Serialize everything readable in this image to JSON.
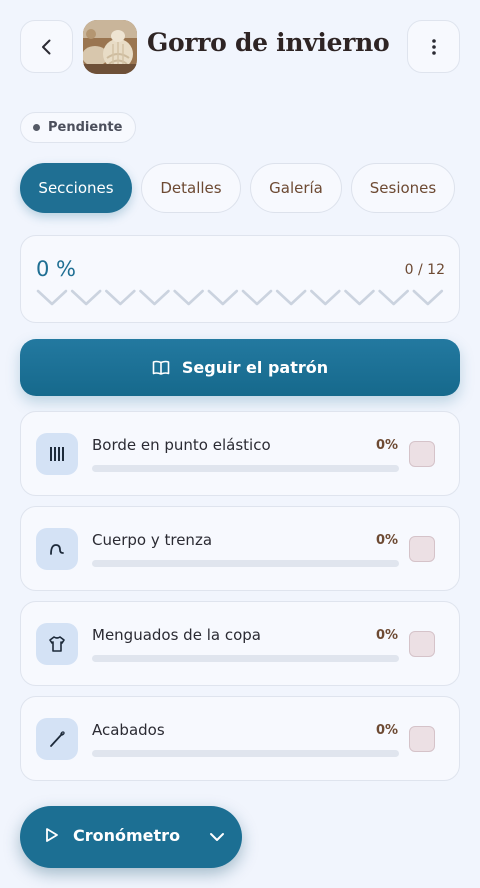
{
  "header": {
    "title": "Gorro de invierno",
    "thumbnail_icon": "knitted-hat-photo",
    "back_icon": "chevron-left-icon",
    "more_icon": "more-vertical-icon"
  },
  "status": {
    "label": "Pendiente"
  },
  "tabs": [
    {
      "label": "Secciones",
      "active": true
    },
    {
      "label": "Detalles",
      "active": false
    },
    {
      "label": "Galería",
      "active": false
    },
    {
      "label": "Sesiones",
      "active": false
    }
  ],
  "progress": {
    "percent_label": "0 %",
    "count_label": "0 / 12",
    "fraction": 0
  },
  "follow_button": {
    "label": "Seguir el patrón",
    "icon": "book-open-icon"
  },
  "sections": [
    {
      "label": "Borde en punto elástico",
      "percent_label": "0%",
      "fraction": 0,
      "icon": "ribbing-icon"
    },
    {
      "label": "Cuerpo y trenza",
      "percent_label": "0%",
      "fraction": 0,
      "icon": "cable-twist-icon"
    },
    {
      "label": "Menguados de la copa",
      "percent_label": "0%",
      "fraction": 0,
      "icon": "shirt-icon"
    },
    {
      "label": "Acabados",
      "percent_label": "0%",
      "fraction": 0,
      "icon": "needle-icon"
    }
  ],
  "timer": {
    "label": "Cronómetro",
    "play_icon": "play-icon",
    "expand_icon": "chevron-down-icon"
  },
  "colors": {
    "accent": "#1f6f93",
    "brown_text": "#6d4a33",
    "background": "#f1f5fd"
  }
}
